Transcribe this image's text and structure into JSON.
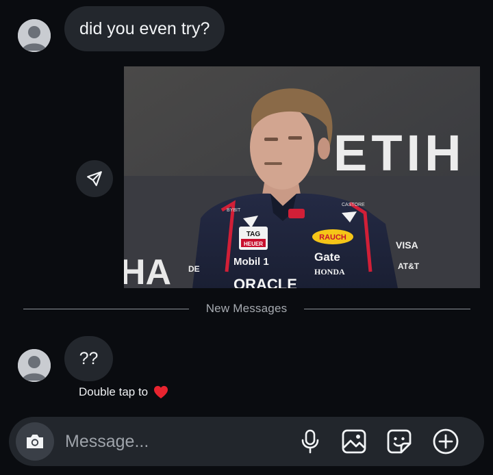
{
  "thread": {
    "messages": [
      {
        "text": "did you even try?"
      },
      {
        "text": "??"
      }
    ],
    "media": {
      "backdrop_text": "ETIH",
      "sponsors": [
        "TAG HEUER",
        "RAUCH",
        "Mobil 1",
        "Gate",
        "HONDA",
        "ORACLE",
        "VISA",
        "AT&T",
        "CASTORE",
        "BYBIT",
        "DE",
        "HA"
      ]
    },
    "divider_label": "New Messages",
    "reaction_hint": "Double tap to",
    "reaction_emoji": "heart-icon"
  },
  "composer": {
    "placeholder": "Message...",
    "icons": [
      "camera-icon",
      "microphone-icon",
      "gallery-icon",
      "sticker-icon",
      "plus-circle-icon"
    ]
  },
  "colors": {
    "background": "#0a0c10",
    "bubble": "#23272d",
    "composer": "#22262c",
    "heart": "#e8242f"
  }
}
